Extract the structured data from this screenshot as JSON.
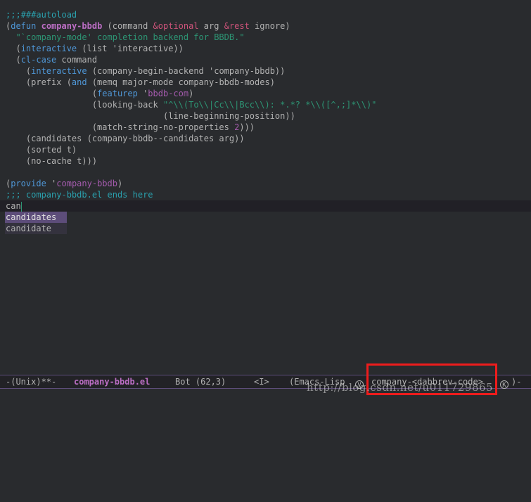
{
  "code": {
    "l01_comment": ";;;###autoload",
    "l02_open": "(",
    "l02_defun": "defun",
    "l02_sp": " ",
    "l02_name": "company-bbdb",
    "l02_args1": " (command ",
    "l02_opt": "&optional",
    "l02_args2": " arg ",
    "l02_rest": "&rest",
    "l02_args3": " ignore)",
    "l03_doc": "  \"`company-mode' completion backend for BBDB.\"",
    "l04_a": "  (",
    "l04_kw": "interactive",
    "l04_b": " (list 'interactive))",
    "l05_a": "  (",
    "l05_kw": "cl-case",
    "l05_b": " command",
    "l06_a": "    (",
    "l06_kw": "interactive",
    "l06_b": " (company-begin-backend 'company-bbdb))",
    "l07_a": "    (prefix (",
    "l07_kw": "and",
    "l07_b": " (memq major-mode company-bbdb-modes)",
    "l08_a": "                 (",
    "l08_kw": "featurep",
    "l08_b": " '",
    "l08_c": "bbdb-com",
    "l08_d": ")",
    "l09_a": "                 (looking-back ",
    "l09_str": "\"^\\\\(To\\\\|Cc\\\\|Bcc\\\\): *.*? *\\\\([^,;]*\\\\)\"",
    "l10_a": "                               (line-beginning-position))",
    "l11_a": "                 (match-string-no-properties ",
    "l11_num": "2",
    "l11_b": ")))",
    "l12": "    (candidates (company-bbdb--candidates arg))",
    "l13": "    (sorted t)",
    "l14": "    (no-cache t)))",
    "l15": "",
    "l16_a": "(",
    "l16_kw": "provide",
    "l16_b": " '",
    "l16_c": "company-bbdb",
    "l16_d": ")",
    "l17_comment": ";;; company-bbdb.el ends here",
    "l18_input": "can"
  },
  "completion_popup": {
    "items": [
      "candidates",
      "candidate"
    ],
    "selected_index": 0
  },
  "modeline": {
    "status": "-(Unix)**-",
    "buffer_name": "company-bbdb.el",
    "position": "Bot (62,3)",
    "state": "<I>",
    "major_mode": "(Emacs-Lisp",
    "circle_v": "V",
    "company_backend": "company-<dabbrev-code>",
    "circle_k": "K",
    "tail": ")-"
  },
  "watermark": "http://blog.csdn.net/u011729865",
  "colors": {
    "background": "#292b2e",
    "keyword": "#4f97d7",
    "function_name": "#bc6ec5",
    "comment": "#2aa1ae",
    "string": "#2d9574",
    "highlight_box": "#ee1c1c"
  }
}
